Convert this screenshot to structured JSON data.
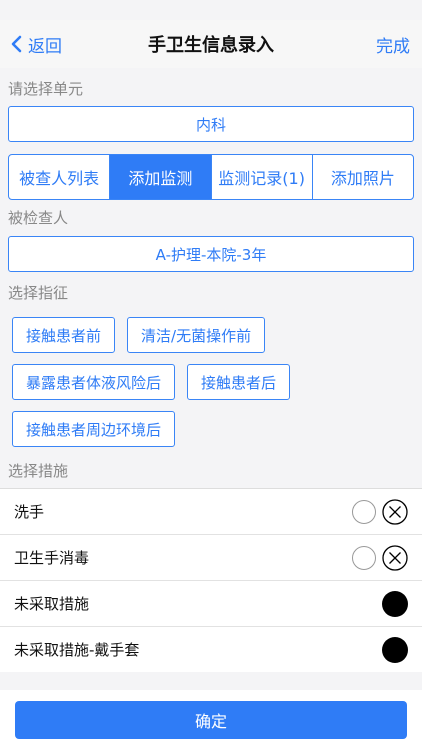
{
  "nav": {
    "back_label": "返回",
    "title": "手卫生信息录入",
    "done_label": "完成"
  },
  "unit": {
    "label": "请选择单元",
    "value": "内科"
  },
  "tabs": [
    {
      "label": "被查人列表",
      "active": false
    },
    {
      "label": "添加监测",
      "active": true
    },
    {
      "label": "监测记录(1)",
      "active": false
    },
    {
      "label": "添加照片",
      "active": false
    }
  ],
  "person": {
    "label": "被检查人",
    "value": "A-护理-本院-3年"
  },
  "indications": {
    "label": "选择指征",
    "items": [
      "接触患者前",
      "清洁/无菌操作前",
      "暴露患者体液风险后",
      "接触患者后",
      "接触患者周边环境后"
    ]
  },
  "measures": {
    "label": "选择措施",
    "items": [
      {
        "label": "洗手",
        "control": "empty-and-x"
      },
      {
        "label": "卫生手消毒",
        "control": "empty-and-x"
      },
      {
        "label": "未采取措施",
        "control": "filled"
      },
      {
        "label": "未采取措施-戴手套",
        "control": "filled"
      }
    ]
  },
  "confirm_label": "确定",
  "colors": {
    "accent": "#2f7cf6",
    "background": "#f4f4f6"
  }
}
